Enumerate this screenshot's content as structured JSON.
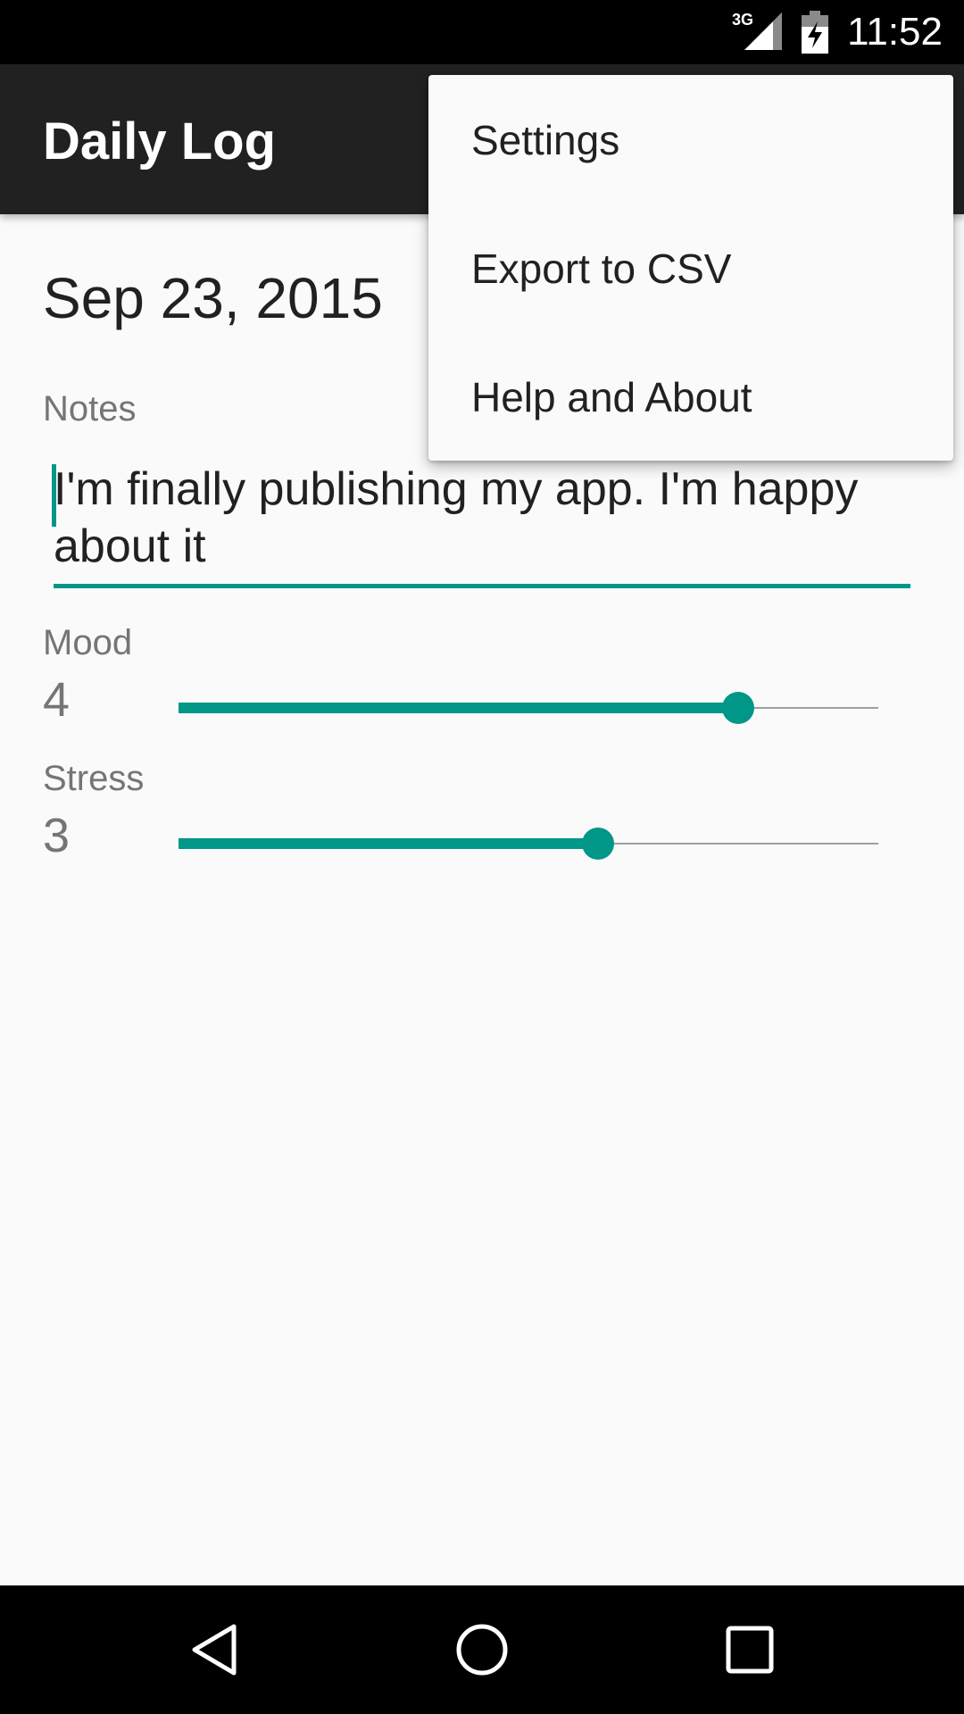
{
  "status_bar": {
    "network": "3G",
    "time": "11:52",
    "icons": [
      "signal-icon",
      "battery-charging-icon"
    ]
  },
  "app_bar": {
    "title": "Daily Log"
  },
  "main": {
    "date": "Sep 23, 2015",
    "notes": {
      "label": "Notes",
      "value": "I'm finally publishing my app. I'm happy about it"
    },
    "mood": {
      "label": "Mood",
      "value": "4",
      "slider_fraction": 0.8
    },
    "stress": {
      "label": "Stress",
      "value": "3",
      "slider_fraction": 0.6
    }
  },
  "overflow_menu": {
    "items": [
      {
        "label": "Settings"
      },
      {
        "label": "Export to CSV"
      },
      {
        "label": "Help and About"
      }
    ]
  },
  "nav_bar": {
    "icons": [
      "back-icon",
      "home-icon",
      "recents-icon"
    ]
  },
  "colors": {
    "accent": "#009688",
    "app_bar": "#212121",
    "background": "#fafafa"
  }
}
